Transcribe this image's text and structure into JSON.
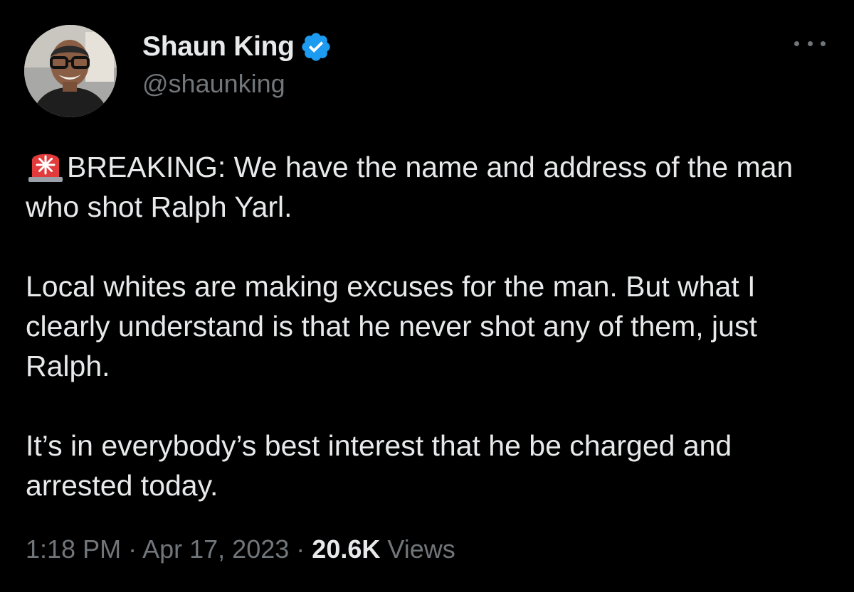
{
  "author": {
    "display_name": "Shaun King",
    "handle": "@shaunking",
    "verified": true,
    "verified_color": "#1d9bf0"
  },
  "menu": {
    "icon": "more-horizontal-icon"
  },
  "tweet": {
    "emoji": "siren-emoji",
    "paragraphs": [
      "BREAKING: We have the name and address of the man who shot Ralph Yarl.",
      "Local whites are making excuses for the man. But what I clearly understand is that he never shot any of them, just Ralph.",
      "It’s in everybody’s best interest that he be charged and arrested today."
    ]
  },
  "meta": {
    "time": "1:18 PM",
    "separator": "·",
    "date": "Apr 17, 2023",
    "views_count": "20.6K",
    "views_label": "Views"
  },
  "colors": {
    "background": "#000000",
    "text": "#e7e9ea",
    "secondary": "#71767b"
  }
}
